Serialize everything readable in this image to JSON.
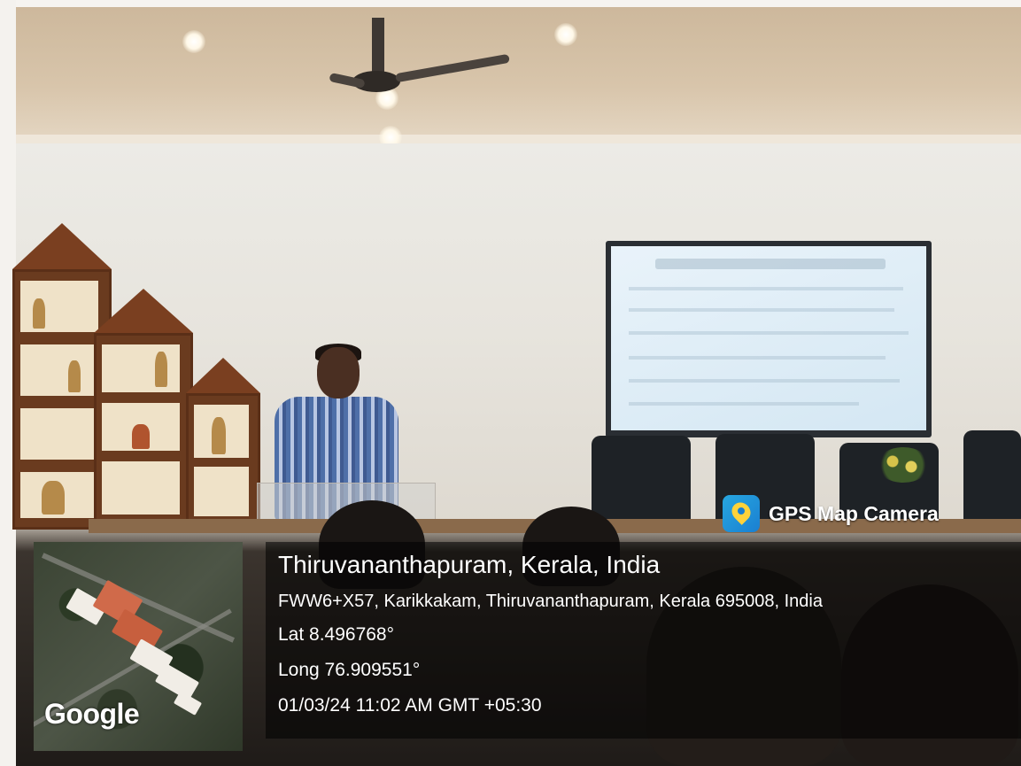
{
  "overlay": {
    "brand_label": "GPS Map Camera",
    "brand_icon": "map-pin-icon",
    "location_title": "Thiruvananthapuram, Kerala, India",
    "address": "FWW6+X57, Karikkakam, Thiruvananthapuram, Kerala 695008, India",
    "latitude": "Lat 8.496768°",
    "longitude": "Long 76.909551°",
    "timestamp": "01/03/24 11:02 AM GMT +05:30",
    "map_logo": "Google"
  },
  "colors": {
    "brand_icon": "#1a7fd1",
    "pin": "#ffd23a",
    "overlay_text": "#ffffff"
  }
}
